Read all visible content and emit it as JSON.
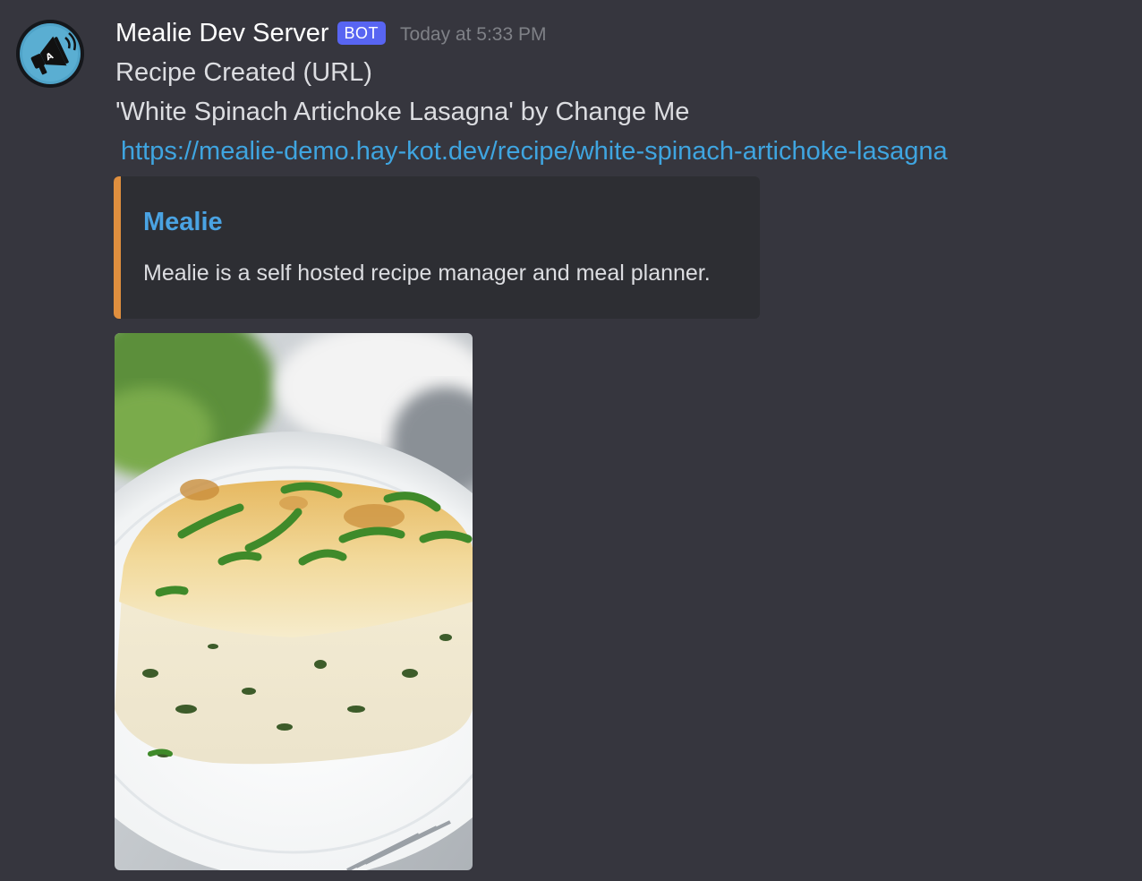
{
  "message": {
    "username": "Mealie Dev Server",
    "bot_tag": "BOT",
    "timestamp": "Today at 5:33 PM",
    "lines": [
      "Recipe Created (URL)",
      "'White Spinach Artichoke Lasagna' by Change Me"
    ],
    "link": "https://mealie-demo.hay-kot.dev/recipe/white-spinach-artichoke-lasagna"
  },
  "embed": {
    "title": "Mealie",
    "description": "Mealie is a self hosted recipe manager and meal planner.",
    "accent_color": "#e08f3e"
  },
  "avatar": {
    "icon": "megaphone-icon"
  },
  "image": {
    "subject": "white spinach artichoke lasagna photo"
  },
  "colors": {
    "background": "#36363e",
    "link": "#3fa5e0",
    "bot_badge": "#5865f2",
    "embed_title": "#4aa3e3"
  }
}
